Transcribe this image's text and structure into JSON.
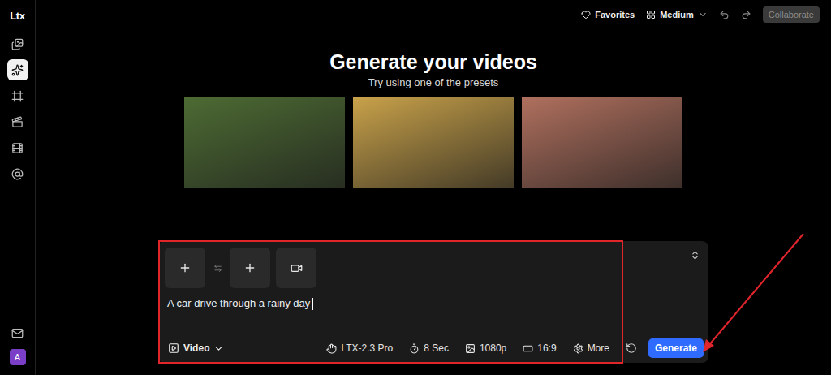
{
  "logo": "Ltx",
  "sidebar": {
    "items": [
      {
        "selected": false
      },
      {
        "selected": true
      },
      {
        "selected": false
      },
      {
        "selected": false
      },
      {
        "selected": false
      },
      {
        "selected": false
      }
    ],
    "avatar": "A"
  },
  "topbar": {
    "favorites": "Favorites",
    "size": "Medium",
    "collaborate": {
      "label": "Collaborate",
      "disabled": true
    }
  },
  "hero": {
    "title": "Generate your videos",
    "subtitle": "Try using one of the presets"
  },
  "presets": [
    {
      "color": "#4d6b33"
    },
    {
      "color": "#c9a24a"
    },
    {
      "color": "#b0705e"
    }
  ],
  "prompt": {
    "slots": [
      {
        "kind": "image"
      },
      {
        "kind": "image"
      },
      {
        "kind": "video"
      }
    ],
    "text": "A car drive through a rainy day",
    "focused": true,
    "mode": "Video",
    "settings": [
      {
        "kind": "model",
        "label": "LTX-2.3 Pro"
      },
      {
        "kind": "duration",
        "label": "8 Sec"
      },
      {
        "kind": "resolution",
        "label": "1080p"
      },
      {
        "kind": "ratio",
        "label": "16:9"
      },
      {
        "kind": "more",
        "label": "More"
      }
    ],
    "generate": "Generate"
  }
}
